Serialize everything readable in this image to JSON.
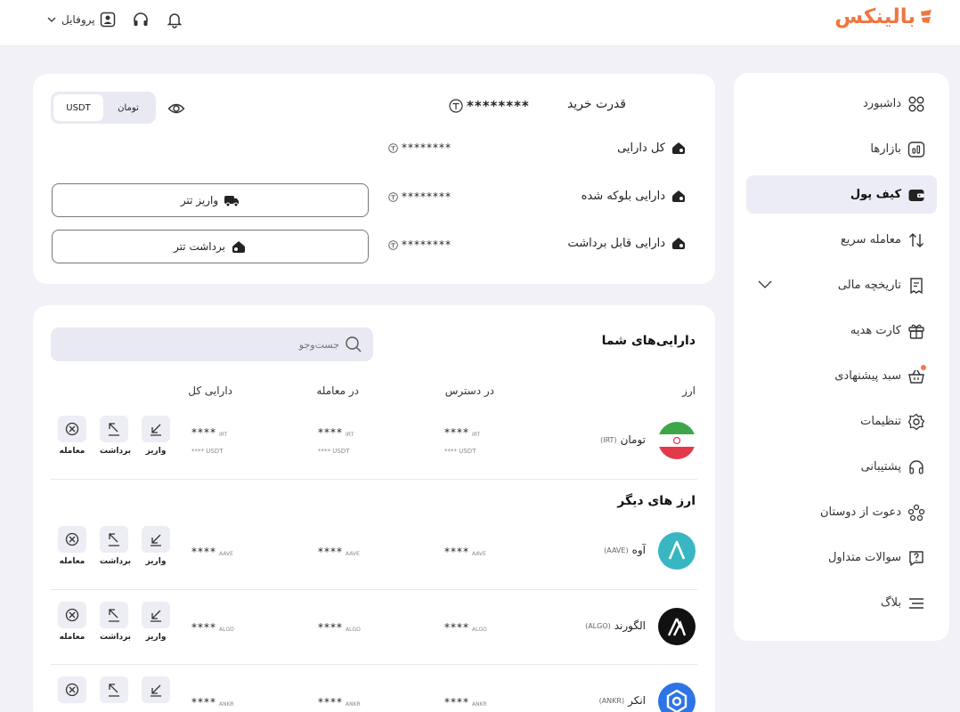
{
  "header": {
    "logo": "بالینکس",
    "profile_label": "پروفایل"
  },
  "sidebar": {
    "items": [
      {
        "label": "داشبورد",
        "icon": "dashboard-grid-icon"
      },
      {
        "label": "بازارها",
        "icon": "chart-icon"
      },
      {
        "label": "کیف پول",
        "icon": "wallet-icon",
        "active": true
      },
      {
        "label": "معامله سریع",
        "icon": "swap-arrows-icon"
      },
      {
        "label": "تاریخچه مالی",
        "icon": "receipt-icon",
        "expandable": true
      },
      {
        "label": "کارت هدیه",
        "icon": "gift-icon"
      },
      {
        "label": "سبد پیشنهادی",
        "icon": "basket-icon",
        "badge": true
      },
      {
        "label": "تنظیمات",
        "icon": "gear-icon"
      },
      {
        "label": "پشتیبانی",
        "icon": "headset-icon"
      },
      {
        "label": "دعوت از دوستان",
        "icon": "users-icon"
      },
      {
        "label": "سوالات متداول",
        "icon": "question-icon"
      },
      {
        "label": "بلاگ",
        "icon": "menu-lines-icon"
      }
    ]
  },
  "summary": {
    "purchase_power_label": "قدرت خرید",
    "purchase_power_value": "********",
    "total_assets_label": "کل دارایی",
    "total_assets_value": "********",
    "blocked_assets_label": "دارایی بلوکه شده",
    "blocked_assets_value": "********",
    "withdrawable_assets_label": "دارایی قابل برداشت",
    "withdrawable_assets_value": "********",
    "currency_toggle": [
      "USDT",
      "تومان"
    ],
    "selected_currency": "USDT",
    "deposit_button": "واریز تتر",
    "withdraw_button": "برداشت تتر"
  },
  "assets": {
    "title": "دارایی‌های شما",
    "search_placeholder": "جست‌وجو",
    "columns": {
      "currency": "ارز",
      "available": "در دسترس",
      "in_trade": "در معامله",
      "total": "دارایی کل"
    },
    "other_title": "ارز های دیگر",
    "actions": {
      "deposit": "واریز",
      "withdraw": "برداشت",
      "trade": "معامله"
    },
    "masked": "****",
    "toman": {
      "name": "تومان",
      "code": "(IRT)",
      "unit": "IRT",
      "sub_unit": "USDT",
      "sub_mask": "****"
    },
    "coins": [
      {
        "name": "آوه",
        "code": "(AAVE)",
        "unit": "AAVE"
      },
      {
        "name": "الگورند",
        "code": "(ALGO)",
        "unit": "ALGO"
      },
      {
        "name": "انکر",
        "code": "(ANKR)",
        "unit": "ANKR"
      }
    ]
  },
  "colors": {
    "brand": "#f0753f",
    "aave": "#38b6c2",
    "ankr": "#2e74e6"
  }
}
